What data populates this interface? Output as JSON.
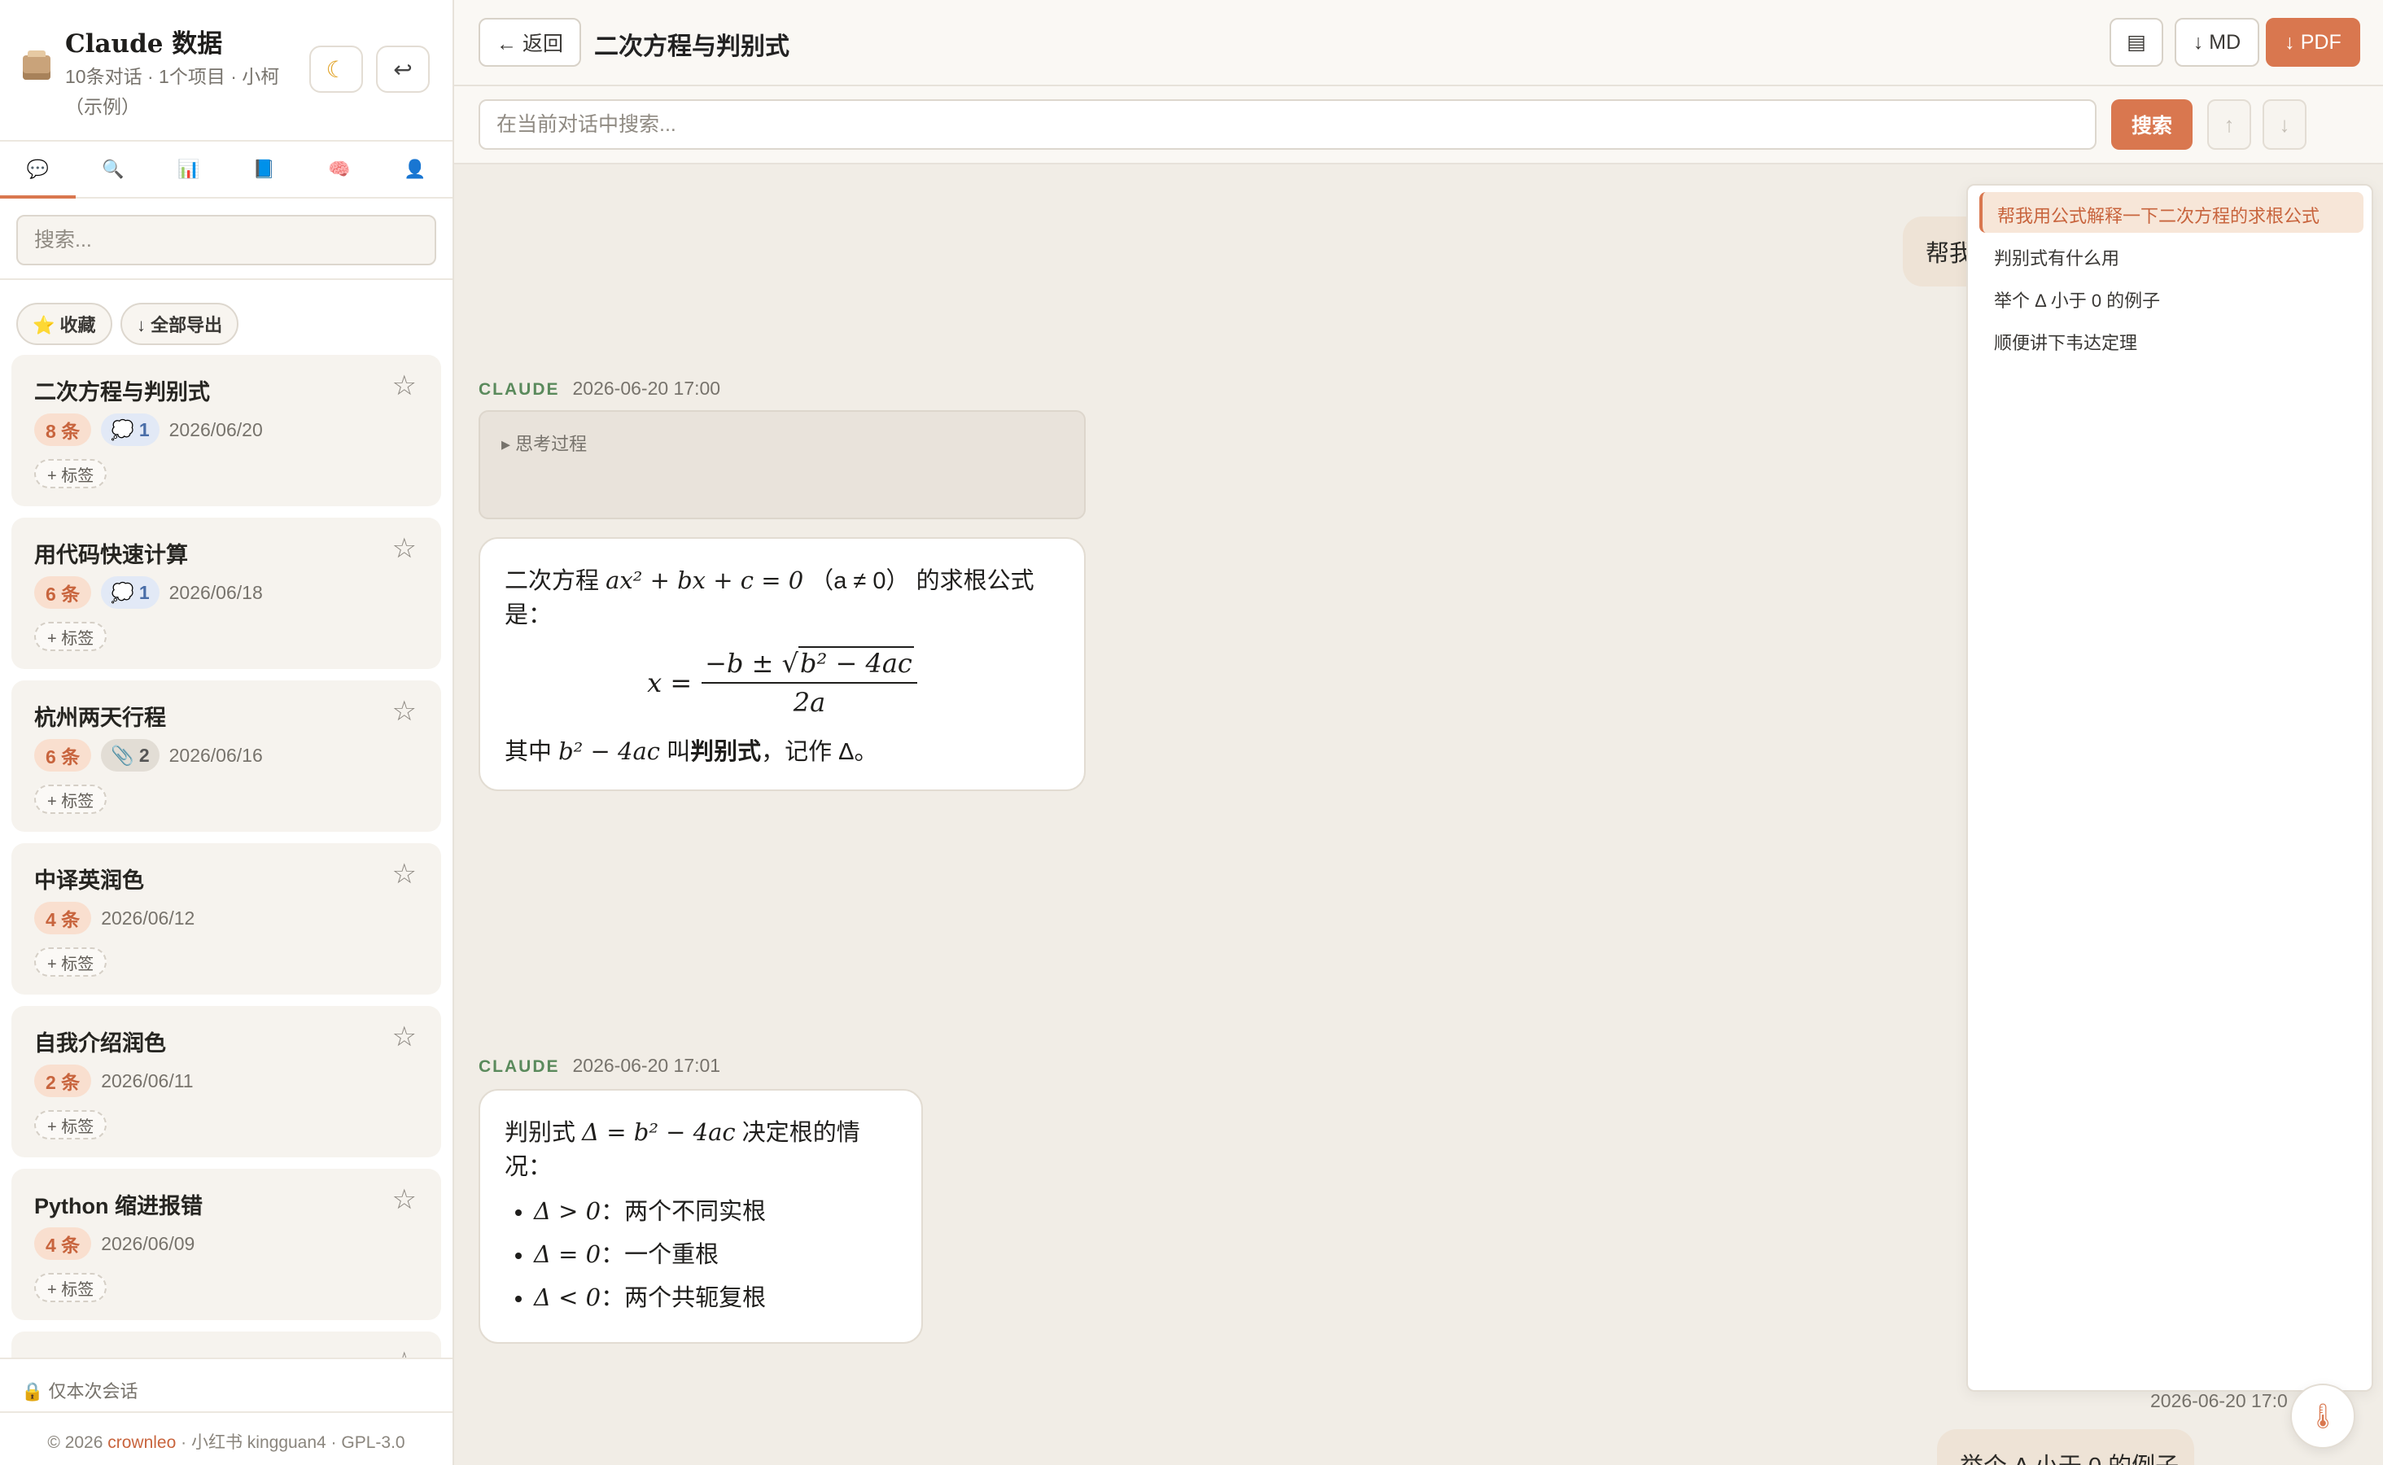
{
  "sidebar": {
    "app_title": "Claude 数据",
    "app_subtitle": "10条对话 · 1个项目 · 小柯（示例）",
    "theme_icon": "☾",
    "exit_icon": "↩",
    "tabs": [
      {
        "name": "chat-icon",
        "glyph": "💬"
      },
      {
        "name": "search-icon",
        "glyph": "🔍"
      },
      {
        "name": "chart-icon",
        "glyph": "📊"
      },
      {
        "name": "book-icon",
        "glyph": "📘"
      },
      {
        "name": "brain-icon",
        "glyph": "🧠"
      },
      {
        "name": "user-icon",
        "glyph": "👤"
      }
    ],
    "search_placeholder": "搜索...",
    "favorites_label": "⭐ 收藏",
    "export_all_label": "↓ 全部导出",
    "conversations": [
      {
        "title": "二次方程与判别式",
        "count": "8 条",
        "extra_type": "blue",
        "extra_icon": "💭",
        "extra_count": "1",
        "date": "2026/06/20",
        "tag_label": "+ 标签"
      },
      {
        "title": "用代码快速计算",
        "count": "6 条",
        "extra_type": "blue",
        "extra_icon": "💭",
        "extra_count": "1",
        "date": "2026/06/18",
        "tag_label": "+ 标签"
      },
      {
        "title": "杭州两天行程",
        "count": "6 条",
        "extra_type": "gray",
        "extra_icon": "📎",
        "extra_count": "2",
        "date": "2026/06/16",
        "tag_label": "+ 标签"
      },
      {
        "title": "中译英润色",
        "count": "4 条",
        "date": "2026/06/12",
        "tag_label": "+ 标签"
      },
      {
        "title": "自我介绍润色",
        "count": "2 条",
        "date": "2026/06/11",
        "tag_label": "+ 标签"
      },
      {
        "title": "Python 缩进报错",
        "count": "4 条",
        "date": "2026/06/09",
        "tag_label": "+ 标签"
      }
    ],
    "session_only": "🔒 仅本次会话",
    "footer_prefix": "© 2026 ",
    "footer_link": "crownleo",
    "footer_suffix": " · 小红书 kingguan4 · GPL-3.0"
  },
  "topbar": {
    "back_label": "← 返回",
    "conversation_title": "二次方程与判别式",
    "doc_icon": "▤",
    "md_label": "↓ MD",
    "pdf_label": "↓ PDF"
  },
  "search": {
    "placeholder": "在当前对话中搜索...",
    "button_label": "搜索",
    "prev_label": "↑",
    "next_label": "↓"
  },
  "messages": {
    "user1_visible": "帮我",
    "claude1": {
      "name": "CLAUDE",
      "time": "2026-06-20 17:00",
      "thinking_label": "▸  思考过程",
      "intro": "二次方程",
      "intro_eq": "ax² + bx + c = 0",
      "intro_cond": "（a ≠ 0）",
      "intro_end": "的求根公式是：",
      "formula_lhs": "x =",
      "formula_num_prefix": "−b ± √",
      "formula_num_rad": "b² − 4ac",
      "formula_den": "2a",
      "outro_pre": "其中",
      "outro_eq": "b² − 4ac",
      "outro_mid": "叫",
      "outro_bold": "判别式",
      "outro_end": "，记作 Δ。"
    },
    "claude2": {
      "name": "CLAUDE",
      "time": "2026-06-20 17:01",
      "intro": "判别式",
      "intro_eq": "Δ = b² − 4ac",
      "intro_end": "决定根的情况：",
      "bullets": [
        {
          "eq": "Δ > 0",
          "text": "：两个不同实根"
        },
        {
          "eq": "Δ = 0",
          "text": "：一个重根"
        },
        {
          "eq": "Δ < 0",
          "text": "：两个共轭复根"
        }
      ]
    },
    "user3_time": "2026-06-20 17:0",
    "user3_visible": "举个 Δ 小于 0 的例子"
  },
  "outline": {
    "items": [
      "帮我用公式解释一下二次方程的求根公式",
      "判别式有什么用",
      "举个 Δ 小于 0 的例子",
      "顺便讲下韦达定理"
    ]
  },
  "float_button_glyph": "🌡",
  "colors": {
    "accent": "#d9774f",
    "claude_label": "#5a8a5c",
    "background": "#f1ede6",
    "user_bubble": "#eee3d6"
  }
}
